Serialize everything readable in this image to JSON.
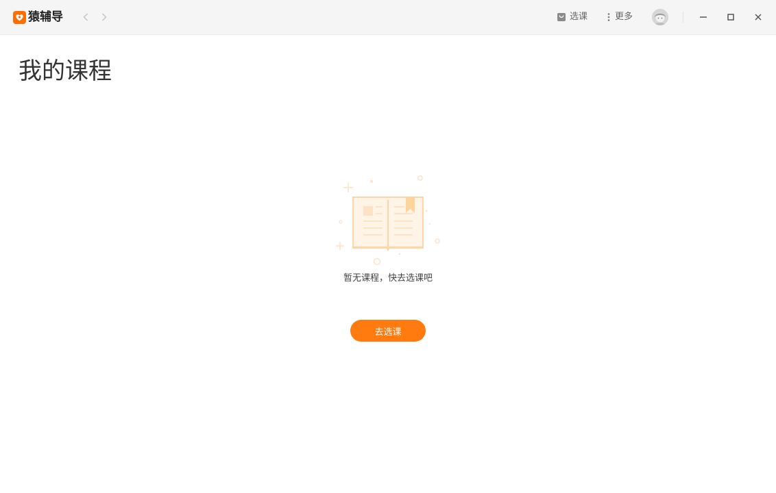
{
  "app": {
    "name": "猿辅导",
    "brand_color": "#ff6e00"
  },
  "titlebar": {
    "actions": {
      "select_course": {
        "label": "选课",
        "icon": "shopping-bag-icon"
      },
      "more": {
        "label": "更多",
        "icon": "more-vertical-icon"
      }
    },
    "window_controls": [
      "minimize-icon",
      "maximize-icon",
      "close-icon"
    ]
  },
  "page": {
    "title": "我的课程"
  },
  "empty_state": {
    "illustration": "open-book-icon",
    "message": "暂无课程，快去选课吧",
    "button_label": "去选课",
    "button_color": "#ff7a0f"
  }
}
